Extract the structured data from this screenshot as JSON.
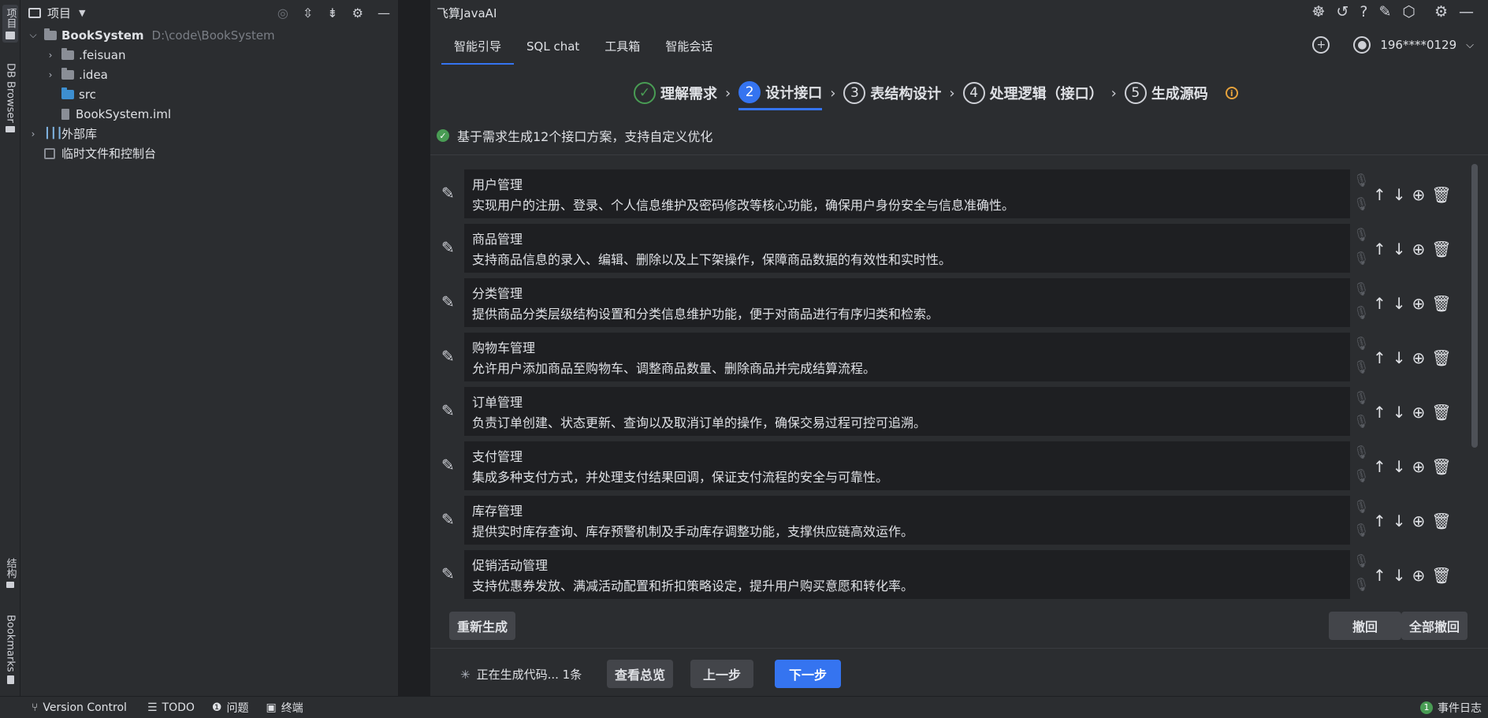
{
  "left_strip": {
    "project_label": "项目",
    "db_browser_label": "DB Browser",
    "structure_label": "结构",
    "bookmarks_label": "Bookmarks"
  },
  "project_panel": {
    "title": "项目",
    "icons": [
      "locate-icon",
      "expand-all-icon",
      "collapse-all-icon",
      "gear-icon",
      "minimize-icon"
    ],
    "tree": {
      "root_name": "BookSystem",
      "root_path": "D:\\code\\BookSystem",
      "children": [
        ".feisuan",
        ".idea",
        "src",
        "BookSystem.iml"
      ],
      "external_libs": "外部库",
      "scratches": "临时文件和控制台"
    }
  },
  "main": {
    "title": "飞算JavaAI",
    "tabs": [
      "智能引导",
      "SQL chat",
      "工具箱",
      "智能会话"
    ],
    "active_tab": "智能引导",
    "user": "196****0129",
    "steps": [
      {
        "num": "✓",
        "label": "理解需求",
        "state": "done"
      },
      {
        "num": "2",
        "label": "设计接口",
        "state": "active"
      },
      {
        "num": "3",
        "label": "表结构设计",
        "state": "todo"
      },
      {
        "num": "4",
        "label": "处理逻辑（接口）",
        "state": "todo"
      },
      {
        "num": "5",
        "label": "生成源码",
        "state": "todo"
      }
    ],
    "status_message": "基于需求生成12个接口方案，支持自定义优化",
    "cards": [
      {
        "name": "用户管理",
        "desc": "实现用户的注册、登录、个人信息维护及密码修改等核心功能，确保用户身份安全与信息准确性。"
      },
      {
        "name": "商品管理",
        "desc": "支持商品信息的录入、编辑、删除以及上下架操作，保障商品数据的有效性和实时性。"
      },
      {
        "name": "分类管理",
        "desc": "提供商品分类层级结构设置和分类信息维护功能，便于对商品进行有序归类和检索。"
      },
      {
        "name": "购物车管理",
        "desc": "允许用户添加商品至购物车、调整商品数量、删除商品并完成结算流程。"
      },
      {
        "name": "订单管理",
        "desc": "负责订单创建、状态更新、查询以及取消订单的操作，确保交易过程可控可追溯。"
      },
      {
        "name": "支付管理",
        "desc": "集成多种支付方式，并处理支付结果回调，保证支付流程的安全与可靠性。"
      },
      {
        "name": "库存管理",
        "desc": "提供实时库存查询、库存预警机制及手动库存调整功能，支撑供应链高效运作。"
      },
      {
        "name": "促销活动管理",
        "desc": "支持优惠券发放、满减活动配置和折扣策略设定，提升用户购买意愿和转化率。"
      }
    ],
    "buttons": {
      "regenerate": "重新生成",
      "undo": "撤回",
      "undo_all": "全部撤回",
      "generating": "正在生成代码... 1条",
      "overview": "查看总览",
      "prev": "上一步",
      "next": "下一步"
    }
  },
  "statusbar": {
    "version_control": "Version Control",
    "todo": "TODO",
    "problems": "问题",
    "terminal": "终端",
    "event_count": "1",
    "event_log": "事件日志"
  },
  "colors": {
    "accent": "#3574f0",
    "success": "#499c54",
    "warning": "#e6a23c"
  }
}
